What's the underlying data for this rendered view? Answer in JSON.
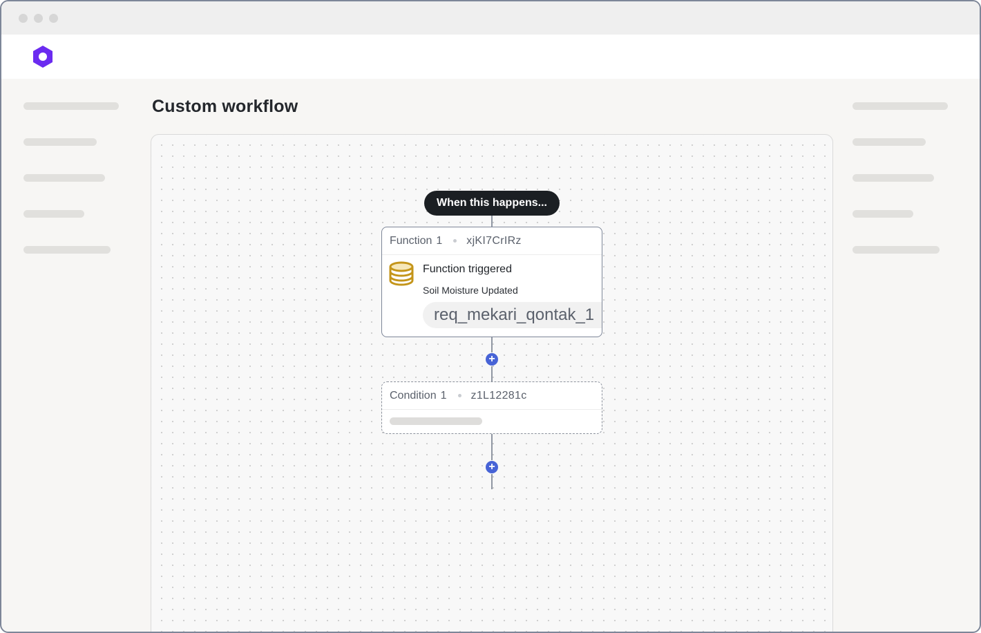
{
  "app": {
    "logo_icon": "hexagon-logo-icon",
    "brand_color": "#6b2bf0"
  },
  "page": {
    "title": "Custom workflow"
  },
  "workflow": {
    "trigger_label": "When this happens...",
    "function_node": {
      "type_label": "Function",
      "number": "1",
      "id": "xjKI7CrIRz",
      "icon": "database-icon",
      "icon_color": "#c4951a",
      "title": "Function triggered",
      "subtitle": "Soil Moisture Updated",
      "chip": "req_mekari_qontak_1"
    },
    "condition_node": {
      "type_label": "Condition",
      "number": "1",
      "id": "z1L12281c"
    },
    "add_step_icon": "plus-icon",
    "accent_color": "#4763d6"
  }
}
